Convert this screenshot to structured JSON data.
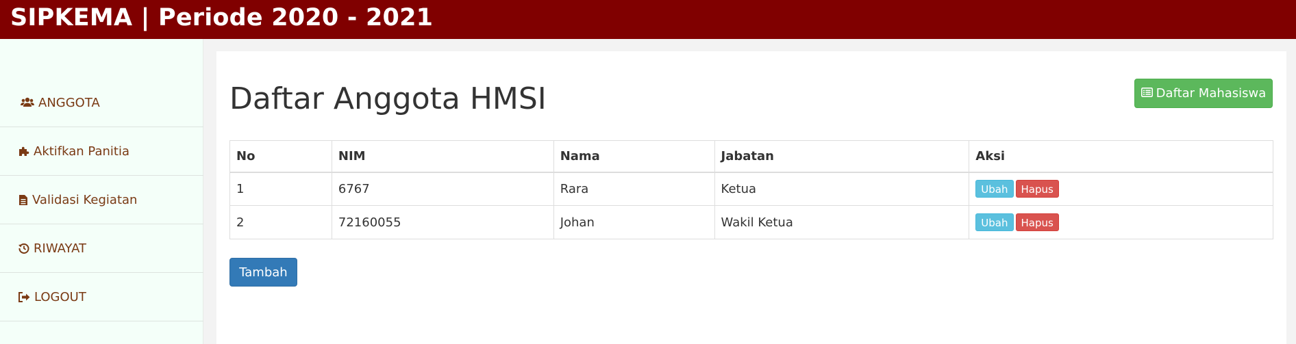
{
  "header": {
    "brand": "SIPKEMA | Periode 2020 - 2021"
  },
  "sidebar": {
    "items": [
      {
        "label": "ANGGOTA",
        "icon": "users-icon"
      },
      {
        "label": "Aktifkan Panitia",
        "icon": "puzzle-icon"
      },
      {
        "label": "Validasi Kegiatan",
        "icon": "file-text-icon"
      },
      {
        "label": "RIWAYAT",
        "icon": "history-icon"
      },
      {
        "label": "LOGOUT",
        "icon": "sign-out-icon"
      }
    ]
  },
  "main": {
    "title": "Daftar Anggota HMSI",
    "list_button": {
      "label": "Daftar Mahasiswa",
      "icon": "list-alt-icon"
    },
    "table": {
      "headers": [
        "No",
        "NIM",
        "Nama",
        "Jabatan",
        "Aksi"
      ],
      "rows": [
        {
          "no": "1",
          "nim": "6767",
          "nama": "Rara",
          "jabatan": "Ketua",
          "edit": "Ubah",
          "delete": "Hapus"
        },
        {
          "no": "2",
          "nim": "72160055",
          "nama": "Johan",
          "jabatan": "Wakil Ketua",
          "edit": "Ubah",
          "delete": "Hapus"
        }
      ]
    },
    "add_button": {
      "label": "Tambah"
    }
  },
  "colors": {
    "header_bg": "#800000",
    "sidebar_bg": "#f4fff9",
    "sidebar_text": "#7a3a14",
    "success": "#5cb85c",
    "primary": "#337ab7",
    "info": "#5bc0de",
    "danger": "#d9534f"
  }
}
